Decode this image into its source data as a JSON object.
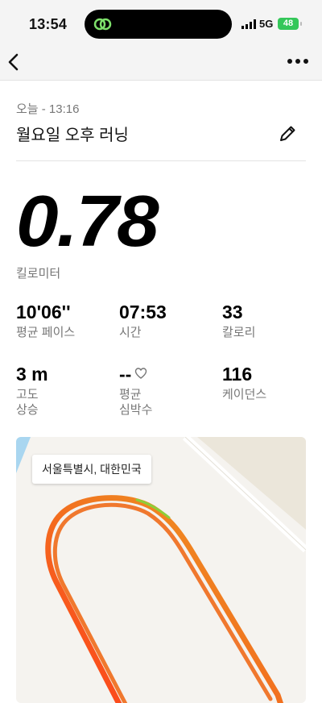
{
  "status_bar": {
    "time": "13:54",
    "network": "5G",
    "battery": "48"
  },
  "activity": {
    "date": "오늘 - 13:16",
    "title": "월요일 오후 러닝",
    "distance": "0.78",
    "distance_unit": "킬로미터"
  },
  "stats": [
    {
      "value": "10'06''",
      "label": "평균 페이스"
    },
    {
      "value": "07:53",
      "label": "시간"
    },
    {
      "value": "33",
      "label": "칼로리"
    },
    {
      "value": "3 m",
      "label": "고도\n상승"
    },
    {
      "value": "--",
      "label": "평균\n심박수"
    },
    {
      "value": "116",
      "label": "케이던스"
    }
  ],
  "map": {
    "location": "서울특별시, 대한민국"
  },
  "colors": {
    "route_start": "#ff3b1a",
    "route_end": "#f0a020",
    "accent": "#34c759"
  }
}
